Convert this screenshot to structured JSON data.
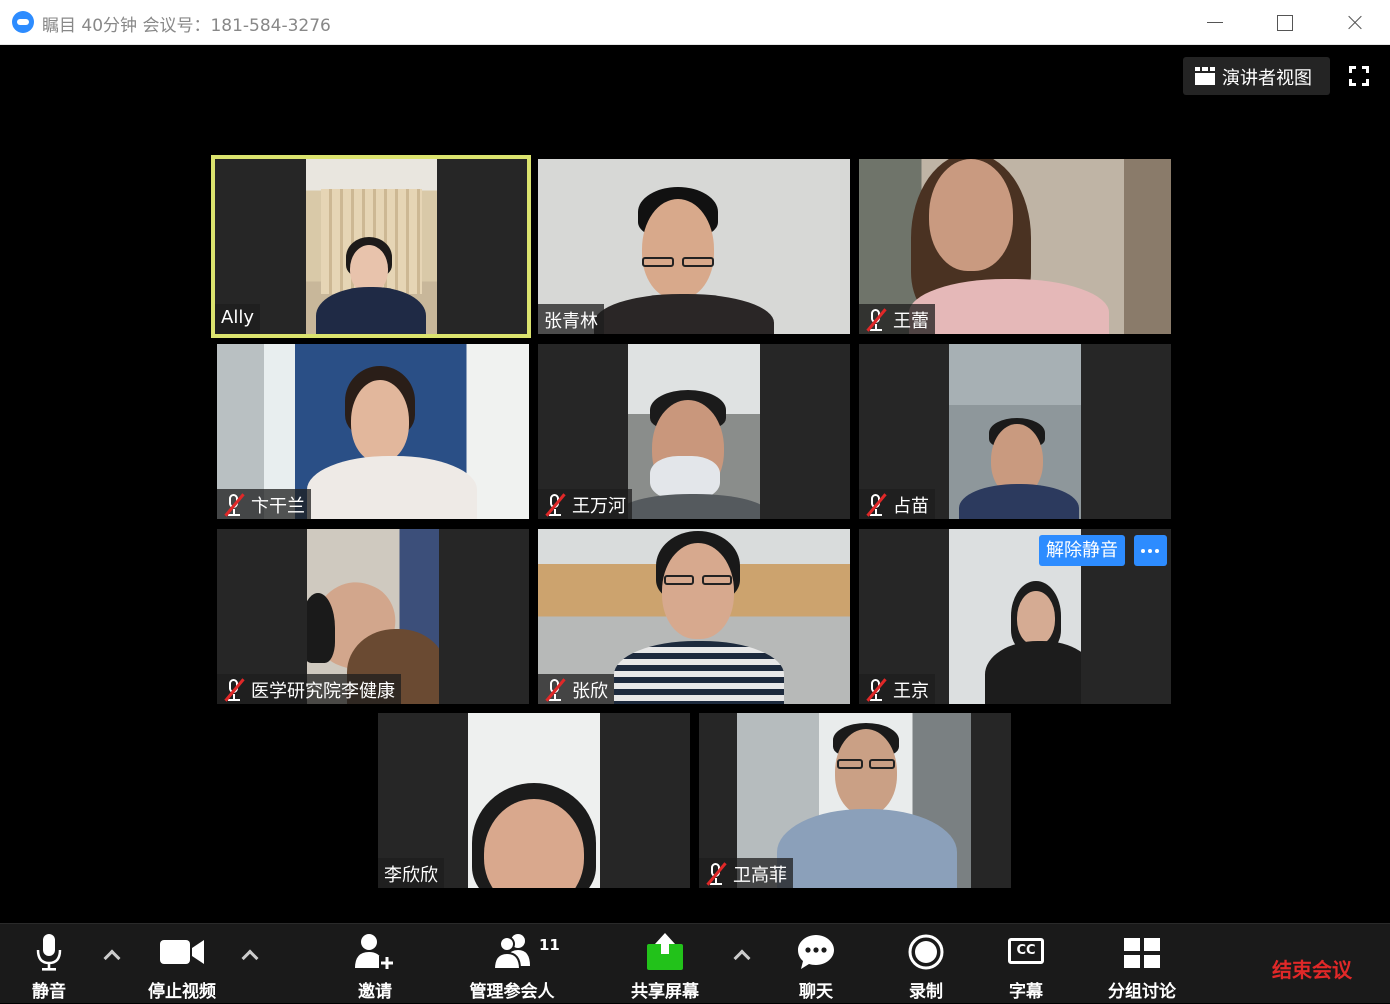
{
  "window": {
    "title": "瞩目 40分钟 会议号：181-584-3276"
  },
  "view": {
    "speaker_view_label": "演讲者视图"
  },
  "participants": [
    {
      "name": "Ally",
      "muted": false,
      "active_speaker": true
    },
    {
      "name": "张青林",
      "muted": false
    },
    {
      "name": "王蕾",
      "muted": true
    },
    {
      "name": "卞干兰",
      "muted": true
    },
    {
      "name": "王万河",
      "muted": true
    },
    {
      "name": "占苗",
      "muted": true
    },
    {
      "name": "医学研究院李健康",
      "muted": true
    },
    {
      "name": "张欣",
      "muted": true
    },
    {
      "name": "王京",
      "muted": true,
      "unmute_label": "解除静音"
    },
    {
      "name": "李欣欣",
      "muted": false
    },
    {
      "name": "卫高菲",
      "muted": true
    }
  ],
  "toolbar": {
    "mute": "静音",
    "stop_video": "停止视频",
    "invite": "邀请",
    "manage_participants": "管理参会人",
    "participant_count": "11",
    "share_screen": "共享屏幕",
    "chat": "聊天",
    "record": "录制",
    "captions": "字幕",
    "captions_icon_text": "CC",
    "breakout": "分组讨论",
    "end_meeting": "结束会议"
  },
  "colors": {
    "accent": "#2d8cff",
    "speaker_border": "#dbe36e",
    "end_meeting": "#e02828",
    "share_green": "#22c21a"
  }
}
